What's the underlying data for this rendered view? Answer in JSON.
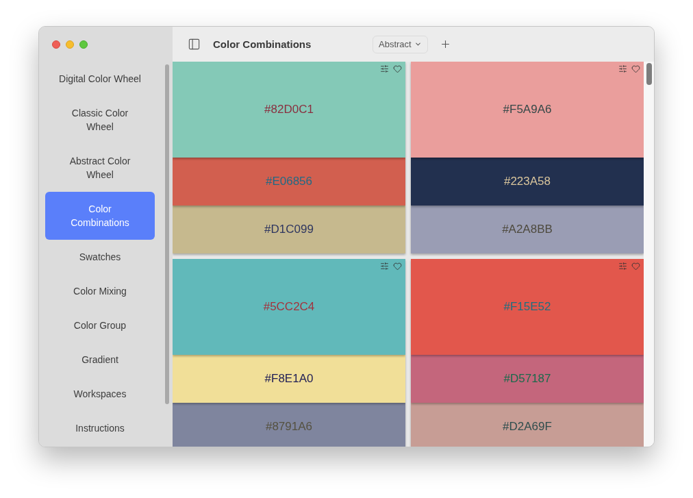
{
  "sidebar": {
    "items": [
      {
        "label": "Digital Color Wheel",
        "selected": false
      },
      {
        "label": "Classic Color\nWheel",
        "selected": false
      },
      {
        "label": "Abstract Color\nWheel",
        "selected": false
      },
      {
        "label": "Color\nCombinations",
        "selected": true
      },
      {
        "label": "Swatches",
        "selected": false
      },
      {
        "label": "Color Mixing",
        "selected": false
      },
      {
        "label": "Color Group",
        "selected": false
      },
      {
        "label": "Gradient",
        "selected": false
      },
      {
        "label": "Workspaces",
        "selected": false
      },
      {
        "label": "Instructions",
        "selected": false
      }
    ]
  },
  "toolbar": {
    "title": "Color Combinations",
    "style_dropdown": {
      "value": "Abstract"
    }
  },
  "combinations": [
    {
      "favorite": false,
      "swatches": [
        {
          "color": "#84c9b7",
          "label": {
            "text": "#82D0C1",
            "color": "#8a2f3f"
          }
        },
        {
          "color": "#d25f4f",
          "label": {
            "text": "#E06856",
            "color": "#226a85"
          }
        },
        {
          "color": "#c6b98e",
          "label": {
            "text": "#D1C099",
            "color": "#2e3660"
          }
        }
      ]
    },
    {
      "favorite": false,
      "swatches": [
        {
          "color": "#ea9e9c",
          "label": {
            "text": "#F5A9A6",
            "color": "#354848"
          }
        },
        {
          "color": "#22304f",
          "label": {
            "text": "#223A58",
            "color": "#d9c59c"
          }
        },
        {
          "color": "#9a9db4",
          "label": {
            "text": "#A2A8BB",
            "color": "#4e4a3e"
          }
        }
      ]
    },
    {
      "favorite": false,
      "swatches": [
        {
          "color": "#61b9ba",
          "label": {
            "text": "#5CC2C4",
            "color": "#a3333d"
          }
        },
        {
          "color": "#f1df98",
          "label": {
            "text": "#F8E1A0",
            "color": "#1f1d55"
          }
        },
        {
          "color": "#7f859e",
          "label": {
            "text": "#8791A6",
            "color": "#555140"
          }
        }
      ]
    },
    {
      "favorite": false,
      "swatches": [
        {
          "color": "#e2574c",
          "label": {
            "text": "#F15E52",
            "color": "#1f6f80"
          }
        },
        {
          "color": "#c4667c",
          "label": {
            "text": "#D57187",
            "color": "#1a6a4c"
          }
        },
        {
          "color": "#c79d95",
          "label": {
            "text": "#D2A69F",
            "color": "#2f4d4d"
          }
        }
      ]
    }
  ]
}
